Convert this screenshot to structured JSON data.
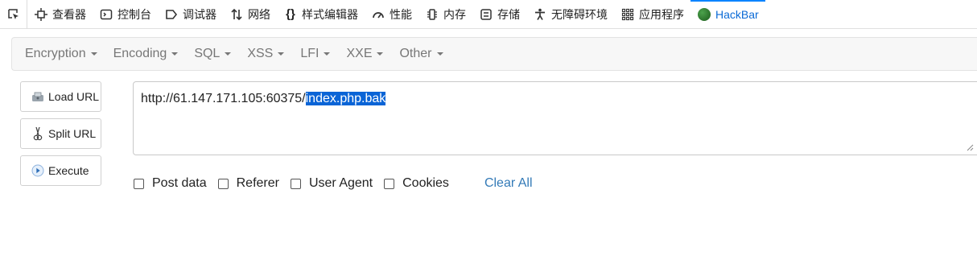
{
  "devtools": {
    "tabs": [
      {
        "label": "查看器",
        "icon": "inspector-icon"
      },
      {
        "label": "控制台",
        "icon": "console-icon"
      },
      {
        "label": "调试器",
        "icon": "debugger-icon"
      },
      {
        "label": "网络",
        "icon": "network-icon"
      },
      {
        "label": "样式编辑器",
        "icon": "style-editor-icon"
      },
      {
        "label": "性能",
        "icon": "performance-icon"
      },
      {
        "label": "内存",
        "icon": "memory-icon"
      },
      {
        "label": "存储",
        "icon": "storage-icon"
      },
      {
        "label": "无障碍环境",
        "icon": "accessibility-icon"
      },
      {
        "label": "应用程序",
        "icon": "application-icon"
      },
      {
        "label": "HackBar",
        "icon": "hackbar-icon"
      }
    ],
    "active_tab": "HackBar",
    "active_color": "#0a6ad6"
  },
  "hackbar": {
    "menu": [
      "Encryption",
      "Encoding",
      "SQL",
      "XSS",
      "LFI",
      "XXE",
      "Other"
    ],
    "buttons": {
      "load_url": "Load URL",
      "split_url": "Split URL",
      "execute": "Execute"
    },
    "url": {
      "prefix": "http://61.147.171.105:60375/",
      "selected": "index.php.bak",
      "selection_color": "#0a64d6"
    },
    "options": [
      "Post data",
      "Referer",
      "User Agent",
      "Cookies"
    ],
    "clear_all": "Clear All"
  }
}
